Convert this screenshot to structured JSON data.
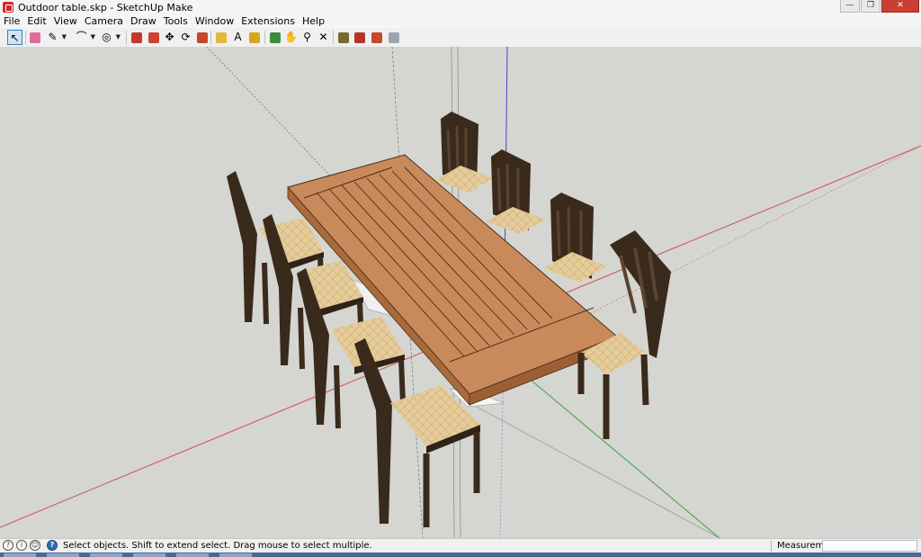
{
  "window": {
    "title": "Outdoor table.skp - SketchUp Make",
    "buttons": {
      "minimize": "—",
      "maximize": "❐",
      "close": "✕"
    }
  },
  "menu": [
    "File",
    "Edit",
    "View",
    "Camera",
    "Draw",
    "Tools",
    "Window",
    "Extensions",
    "Help"
  ],
  "toolbar": {
    "tools": [
      {
        "name": "select-tool",
        "icon": "cursor-arrow-icon",
        "glyph": "↖",
        "active": true
      },
      {
        "name": "eraser-tool",
        "icon": "eraser-icon",
        "color": "#e06c9c"
      },
      {
        "name": "line-tool",
        "icon": "pencil-icon",
        "glyph": "✎",
        "dropdown": true
      },
      {
        "name": "arc-tool",
        "icon": "arc-icon",
        "glyph": "⌒",
        "dropdown": true
      },
      {
        "name": "shapes-tool",
        "icon": "shapes-icon",
        "glyph": "◎",
        "dropdown": true
      },
      {
        "name": "push-pull-tool",
        "icon": "push-pull-icon",
        "color": "#c0392b"
      },
      {
        "name": "offset-tool",
        "icon": "offset-icon",
        "color": "#d0402c"
      },
      {
        "name": "move-tool",
        "icon": "move-icon",
        "glyph": "✥"
      },
      {
        "name": "rotate-tool",
        "icon": "rotate-icon",
        "glyph": "⟳"
      },
      {
        "name": "scale-tool",
        "icon": "scale-icon",
        "color": "#c9452d"
      },
      {
        "name": "tape-measure-tool",
        "icon": "tape-measure-icon",
        "color": "#e5b63b"
      },
      {
        "name": "text-tool",
        "icon": "text-icon",
        "glyph": "A"
      },
      {
        "name": "paint-bucket-tool",
        "icon": "paint-bucket-icon",
        "color": "#d7a51e"
      },
      {
        "name": "orbit-tool",
        "icon": "orbit-icon",
        "color": "#3e8a3e"
      },
      {
        "name": "pan-tool",
        "icon": "pan-hand-icon",
        "glyph": "✋"
      },
      {
        "name": "zoom-tool",
        "icon": "zoom-magnifier-icon",
        "glyph": "⚲"
      },
      {
        "name": "zoom-extents-tool",
        "icon": "zoom-extents-icon",
        "glyph": "✕"
      },
      {
        "name": "warehouse-tool",
        "icon": "3d-warehouse-icon",
        "color": "#7a6a2a"
      },
      {
        "name": "extension-warehouse-tool",
        "icon": "extension-warehouse-icon",
        "color": "#b3342c"
      },
      {
        "name": "share-model-tool",
        "icon": "share-model-icon",
        "color": "#c44a28"
      },
      {
        "name": "layout-tool",
        "icon": "send-to-layout-icon",
        "color": "#9aa5b1"
      }
    ]
  },
  "status": {
    "message": "Select objects. Shift to extend select. Drag mouse to select multiple.",
    "measurements_label": "Measurements",
    "measurements_value": ""
  },
  "colors": {
    "viewport_bg": "#d5d5d1",
    "wood_top": "#c88a5a",
    "wood_edge": "#a96a3c",
    "chair_wood": "#3a2a1c",
    "seat": "#e5cc9a",
    "axis_red": "#d05050",
    "axis_green": "#3ea43e",
    "axis_blue": "#4444cc"
  }
}
